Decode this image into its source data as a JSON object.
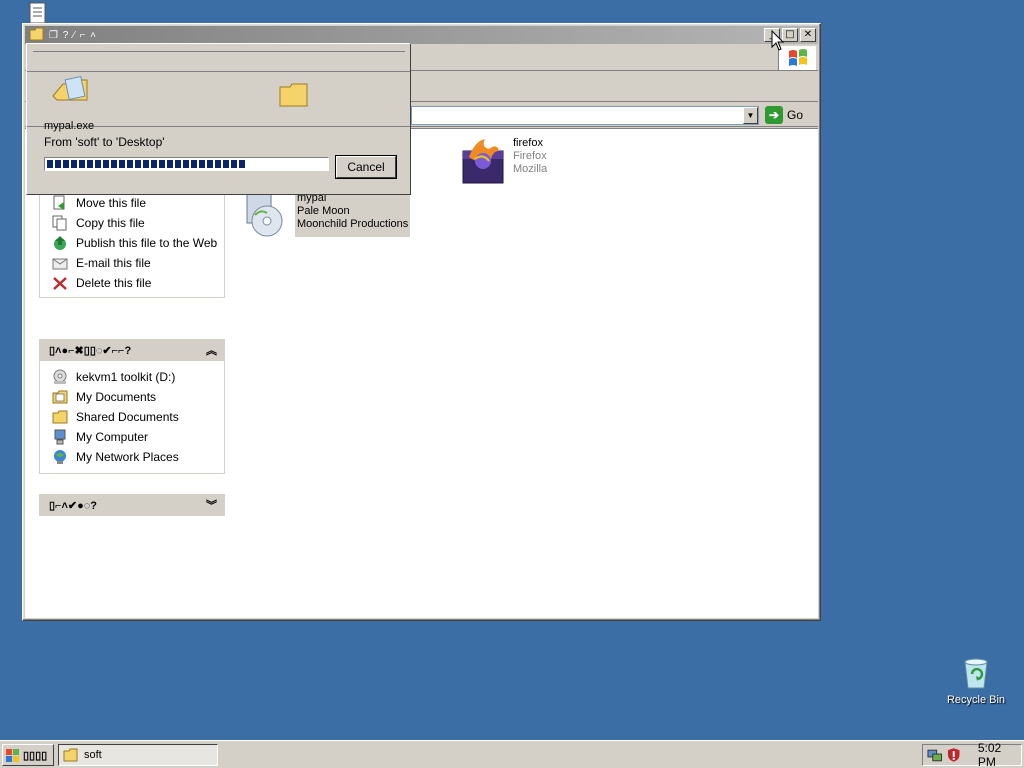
{
  "desktop": {
    "recycle_bin_label": "Recycle Bin"
  },
  "window": {
    "title_glyphs": "❐ ? ⁄ ⌐ ˄",
    "address": {
      "value": "",
      "go_label": "Go"
    },
    "file_tasks": {
      "items": [
        {
          "label": "Move this file",
          "icon": "move-icon"
        },
        {
          "label": "Copy this file",
          "icon": "copy-icon"
        },
        {
          "label": "Publish this file to the Web",
          "icon": "publish-icon"
        },
        {
          "label": "E-mail this file",
          "icon": "email-icon"
        },
        {
          "label": "Delete this file",
          "icon": "delete-icon"
        }
      ]
    },
    "other_places": {
      "header": "▯˄●⌐✖▯▯◌✔⌐⌐?",
      "items": [
        {
          "label": "kekvm1 toolkit (D:)",
          "icon": "drive-icon"
        },
        {
          "label": "My Documents",
          "icon": "documents-icon"
        },
        {
          "label": "Shared Documents",
          "icon": "folder-icon"
        },
        {
          "label": "My Computer",
          "icon": "computer-icon"
        },
        {
          "label": "My Network Places",
          "icon": "network-icon"
        }
      ]
    },
    "details": {
      "header": "▯⌐˄✔●◌?"
    },
    "files": [
      {
        "name": "firefox",
        "line2": "Firefox",
        "line3": "Mozilla"
      },
      {
        "name": "mypal",
        "line2": "Pale Moon",
        "line3": "Moonchild Productions"
      }
    ]
  },
  "copy_dialog": {
    "filename": "mypal.exe",
    "from_to": "From 'soft' to 'Desktop'",
    "progress": 0.71,
    "cancel_label": "Cancel"
  },
  "taskbar": {
    "start_label": "▯▯▯▯",
    "task_label": "soft",
    "clock": "5:02 PM"
  },
  "colors": {
    "desktop": "#3a6ea5",
    "progress": "#0a246a"
  }
}
